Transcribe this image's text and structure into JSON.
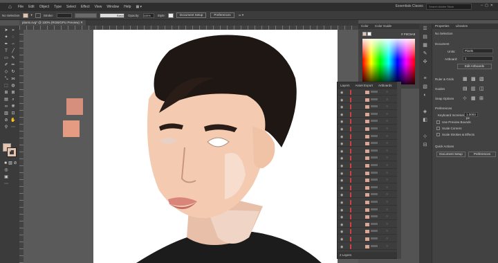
{
  "menubar": {
    "items": [
      "File",
      "Edit",
      "Object",
      "Type",
      "Select",
      "Effect",
      "View",
      "Window",
      "Help"
    ],
    "workspace": "Essentials Classic",
    "search_placeholder": "Search Adobe Stock"
  },
  "control": {
    "selection": "No Selection",
    "stroke_label": "Stroke:",
    "stroke_value": "",
    "brush": "Basic",
    "opacity_label": "Opacity:",
    "opacity_value": "100%",
    "style_label": "Style:",
    "doc_setup": "Document Setup",
    "preferences": "Preferences"
  },
  "document": {
    "tab_title": "plants.svg* @ 100% (RGB/GPU Preview)"
  },
  "colors": {
    "fill": "#e6c3ad",
    "swatch1": "#d78f7d",
    "swatch2": "#e59b81"
  },
  "color_panel": {
    "tabs": [
      "Color",
      "Color Guide"
    ],
    "hex": "F9C9A9"
  },
  "layers_panel": {
    "tabs": [
      "Layers",
      "Asset Export",
      "Artboards"
    ],
    "footer": "2 Layers",
    "rows": 22
  },
  "properties": {
    "tabs": [
      "Properties",
      "Libraries"
    ],
    "no_selection": "No Selection",
    "document_label": "Document",
    "units_label": "Units:",
    "units_value": "Pixels",
    "artboard_label": "Artboard:",
    "artboard_value": "1",
    "edit_artboards": "Edit Artboards",
    "ruler_grids": "Ruler & Grids",
    "guides": "Guides",
    "snap_options": "Snap Options",
    "preferences_label": "Preferences",
    "keyboard_increment_label": "Keyboard Increment:",
    "keyboard_increment_value": "1.0003 px",
    "use_preview_bounds": "Use Preview Bounds",
    "scale_corners": "Scale Corners",
    "scale_strokes": "Scale Strokes & Effects",
    "quick_actions": "Quick Actions",
    "document_setup_btn": "Document Setup",
    "preferences_btn": "Preferences"
  }
}
